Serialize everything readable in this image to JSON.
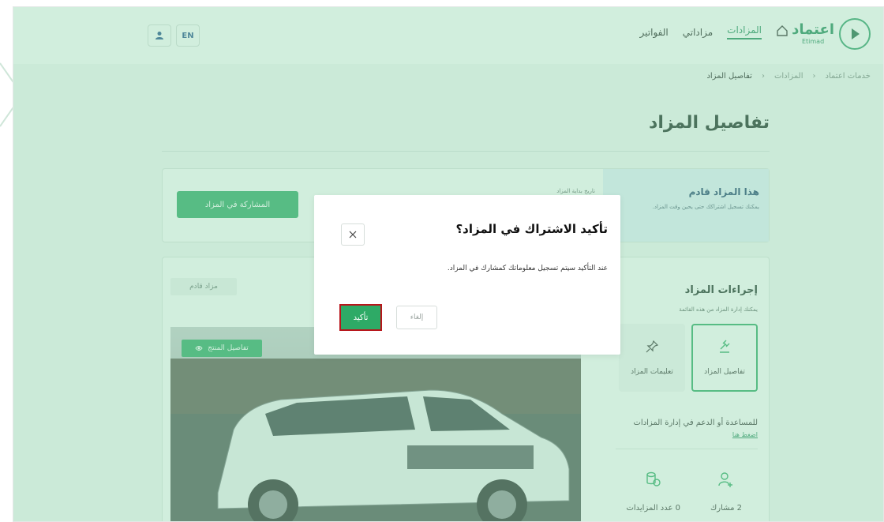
{
  "header": {
    "logo_ar": "اعتماد",
    "logo_en": "Etimad",
    "nav": [
      "المزادات",
      "مزاداتي",
      "الفواتير"
    ],
    "lang_button": "EN"
  },
  "breadcrumb": [
    "خدمات اعتماد",
    "المزادات",
    "تفاصيل المزاد"
  ],
  "page_title": "تفاصيل المزاد",
  "upcoming": {
    "title": "هذا المزاد قادم",
    "desc": "يمكنك تسجيل اشتراكك حتى يحين وقت المزاد.",
    "start_date_label": "تاريخ بداية المزاد",
    "participate_button": "المشاركة في المزاد"
  },
  "actions": {
    "title": "إجراءات المزاد",
    "subtitle": "يمكنك إدارة المزاد من هذه القائمة",
    "cards": [
      "تفاصيل المزاد",
      "تعليمات المزاد"
    ],
    "help_text": "للمساعدة أو الدعم في إدارة المزادات",
    "help_link": "اضغط هنا",
    "stats": [
      {
        "value": "2",
        "label": "مشارك"
      },
      {
        "value": "0",
        "label": "عدد المزايدات"
      }
    ]
  },
  "auction": {
    "status_badge": "مزاد قادم",
    "product_button": "تفاصيل المنتج"
  },
  "modal": {
    "title": "تأكيد الاشتراك في المزاد؟",
    "body": "عند التأكيد سيتم تسجيل معلوماتك كمشارك في المزاد.",
    "cancel": "إلغاء",
    "confirm": "تأكيد"
  },
  "colors": {
    "primary": "#2eaa66",
    "overlay": "rgba(145,215,175,0.42)",
    "highlight": "#b8151b"
  }
}
